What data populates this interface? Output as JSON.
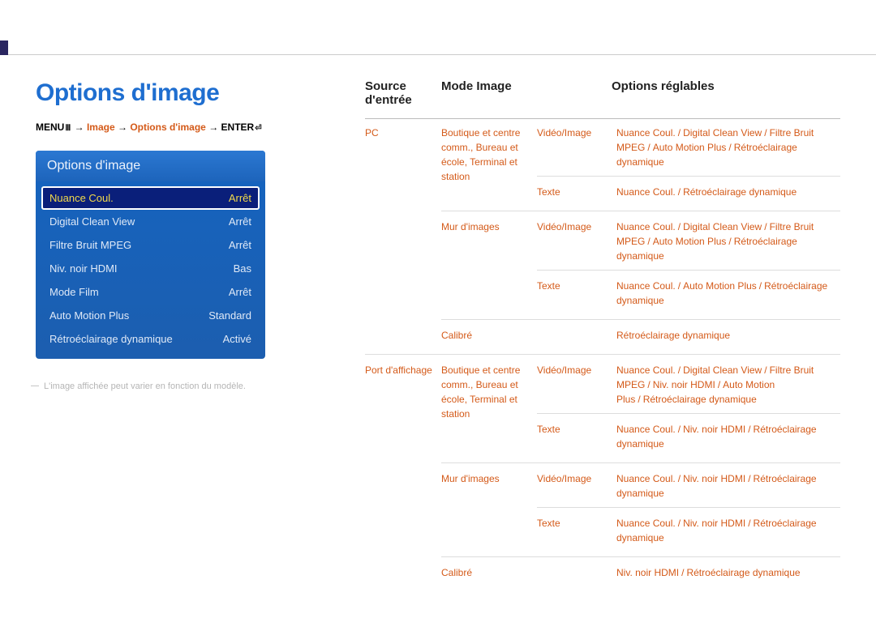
{
  "page_title": "Options d'image",
  "breadcrumb": {
    "prefix": "MENU",
    "icon1": "Ⅲ",
    "arrow": "→",
    "p1": "Image",
    "p2": "Options d'image",
    "suffix": "ENTER",
    "icon2": "⏎"
  },
  "panel": {
    "title": "Options d'image",
    "rows": [
      {
        "label": "Nuance Coul.",
        "value": "Arrêt",
        "selected": true
      },
      {
        "label": "Digital Clean View",
        "value": "Arrêt",
        "selected": false
      },
      {
        "label": "Filtre Bruit MPEG",
        "value": "Arrêt",
        "selected": false
      },
      {
        "label": "Niv. noir HDMI",
        "value": "Bas",
        "selected": false
      },
      {
        "label": "Mode Film",
        "value": "Arrêt",
        "selected": false
      },
      {
        "label": "Auto Motion Plus",
        "value": "Standard",
        "selected": false
      },
      {
        "label": "Rétroéclairage dynamique",
        "value": "Activé",
        "selected": false
      }
    ]
  },
  "footnote": "L'image affichée peut varier en fonction du modèle.",
  "table": {
    "headers": {
      "a": "Source d'entrée",
      "b": "Mode Image",
      "c": "Options réglables"
    },
    "groups": [
      {
        "source": "PC",
        "modes": [
          {
            "mode": "Boutique et centre comm., Bureau et école, Terminal et station",
            "subs": [
              {
                "c": "Vidéo/Image",
                "d": [
                  "Nuance Coul.",
                  "Digital Clean View",
                  "Filtre Bruit MPEG",
                  "Auto Motion Plus",
                  "Rétroéclairage dynamique"
                ]
              },
              {
                "c": "Texte",
                "d": [
                  "Nuance Coul.",
                  "Rétroéclairage dynamique"
                ]
              }
            ]
          },
          {
            "mode": "Mur d'images",
            "subs": [
              {
                "c": "Vidéo/Image",
                "d": [
                  "Nuance Coul.",
                  "Digital Clean View",
                  "Filtre Bruit MPEG",
                  "Auto Motion Plus",
                  "Rétroéclairage dynamique"
                ]
              },
              {
                "c": "Texte",
                "d": [
                  "Nuance Coul.",
                  "Auto Motion Plus",
                  "Rétroéclairage dynamique"
                ]
              }
            ]
          },
          {
            "mode": "Calibré",
            "subs": [
              {
                "c": "",
                "d": [
                  "Rétroéclairage dynamique"
                ]
              }
            ]
          }
        ]
      },
      {
        "source": "Port d'affichage",
        "modes": [
          {
            "mode": "Boutique et centre comm., Bureau et école, Terminal et station",
            "subs": [
              {
                "c": "Vidéo/Image",
                "d": [
                  "Nuance Coul.",
                  "Digital Clean View",
                  "Filtre Bruit MPEG",
                  "Niv. noir HDMI",
                  "Auto Motion Plus",
                  "Rétroéclairage dynamique"
                ]
              },
              {
                "c": "Texte",
                "d": [
                  "Nuance Coul.",
                  "Niv. noir HDMI",
                  "Rétroéclairage dynamique"
                ]
              }
            ]
          },
          {
            "mode": "Mur d'images",
            "subs": [
              {
                "c": "Vidéo/Image",
                "d": [
                  "Nuance Coul.",
                  "Niv. noir HDMI",
                  "Rétroéclairage dynamique"
                ]
              },
              {
                "c": "Texte",
                "d": [
                  "Nuance Coul.",
                  "Niv. noir HDMI",
                  "Rétroéclairage dynamique"
                ]
              }
            ]
          },
          {
            "mode": "Calibré",
            "subs": [
              {
                "c": "",
                "d": [
                  "Niv. noir HDMI",
                  "Rétroéclairage dynamique"
                ]
              }
            ]
          }
        ]
      }
    ]
  }
}
